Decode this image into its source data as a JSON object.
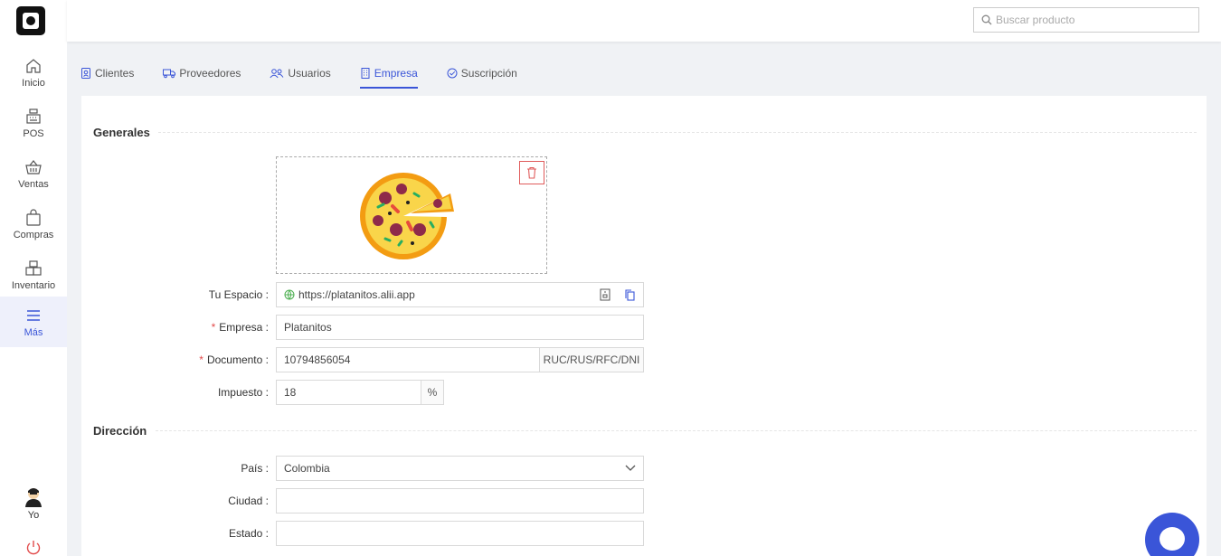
{
  "sidebar": {
    "items": [
      {
        "label": "Inicio"
      },
      {
        "label": "POS"
      },
      {
        "label": "Ventas"
      },
      {
        "label": "Compras"
      },
      {
        "label": "Inventario"
      },
      {
        "label": "Más"
      }
    ],
    "user_label": "Yo"
  },
  "search": {
    "placeholder": "Buscar producto"
  },
  "tabs": [
    {
      "label": "Clientes"
    },
    {
      "label": "Proveedores"
    },
    {
      "label": "Usuarios"
    },
    {
      "label": "Empresa"
    },
    {
      "label": "Suscripción"
    }
  ],
  "generales": {
    "title": "Generales",
    "espacio_label": "Tu Espacio",
    "espacio_value": "https://platanitos.alii.app",
    "empresa_label": "Empresa",
    "empresa_value": "Platanitos",
    "documento_label": "Documento",
    "documento_value": "10794856054",
    "documento_addon": "RUC/RUS/RFC/DNI",
    "impuesto_label": "Impuesto",
    "impuesto_value": "18",
    "impuesto_addon": "%"
  },
  "direccion": {
    "title": "Dirección",
    "pais_label": "País",
    "pais_value": "Colombia",
    "ciudad_label": "Ciudad",
    "ciudad_value": "",
    "estado_label": "Estado",
    "estado_value": ""
  },
  "colors": {
    "accent": "#3a55d8",
    "danger": "#e05b5b"
  }
}
